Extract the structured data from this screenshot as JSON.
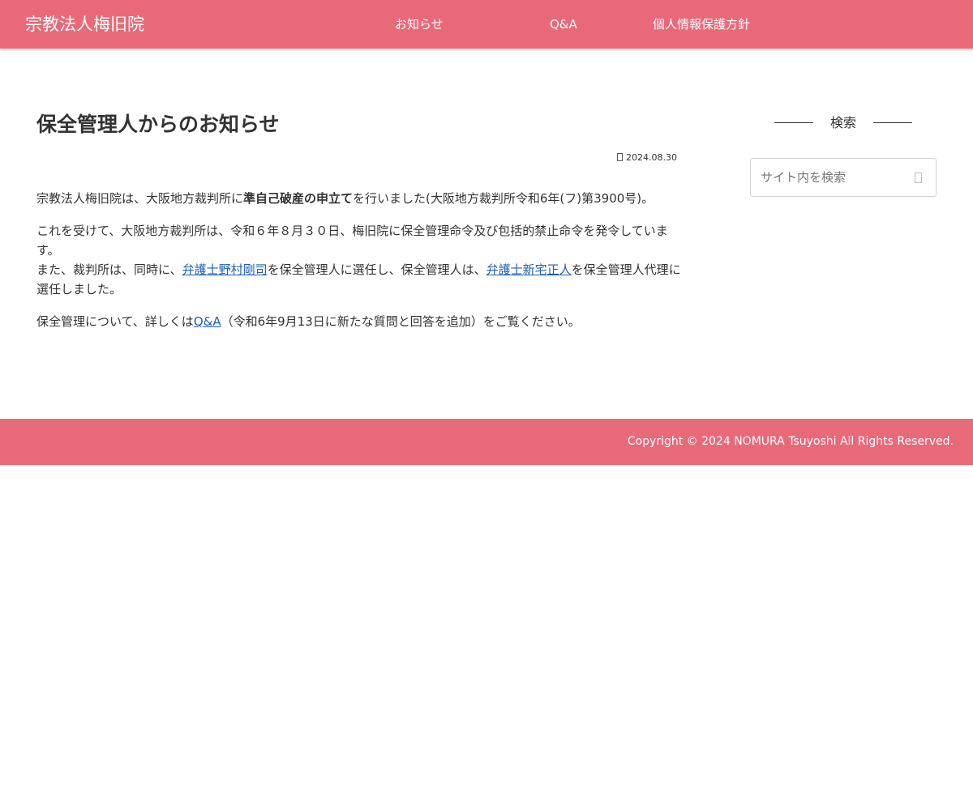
{
  "header": {
    "site_title": "宗教法人梅旧院",
    "nav": [
      {
        "label": "お知らせ"
      },
      {
        "label": "Q&A"
      },
      {
        "label": "個人情報保護方針"
      }
    ]
  },
  "article": {
    "title": "保全管理人からのお知らせ",
    "date": "2024.08.30",
    "p1": {
      "pre": "宗教法人梅旧院は、大阪地方裁判所に",
      "strong": "準自己破産の申立て",
      "post": "を行いました(大阪地方裁判所令和6年(フ)第3900号)。"
    },
    "p2": {
      "line1": "これを受けて、大阪地方裁判所は、令和６年８月３０日、梅旧院に保全管理命令及び包括的禁止命令を発令しています。",
      "pre": "また、裁判所は、同時に、",
      "link1": "弁護士野村剛司",
      "mid": "を保全管理人に選任し、保全管理人は、",
      "link2": "弁護士新宅正人",
      "post": "を保全管理人代理に選任しました。"
    },
    "p3": {
      "pre": "保全管理について、詳しくは",
      "link": "Q&A",
      "post": "（令和6年9月13日に新たな質問と回答を追加）をご覧ください。"
    }
  },
  "sidebar": {
    "search_title": "検索",
    "search_placeholder": "サイト内を検索",
    "search_value": ""
  },
  "footer": {
    "copyright": "Copyright © 2024 NOMURA Tsuyoshi All Rights Reserved."
  },
  "colors": {
    "accent": "#e86a79",
    "link": "#1e5fb4",
    "text": "#333333"
  },
  "icons": {
    "date": "clock-icon",
    "search": "search-icon"
  }
}
